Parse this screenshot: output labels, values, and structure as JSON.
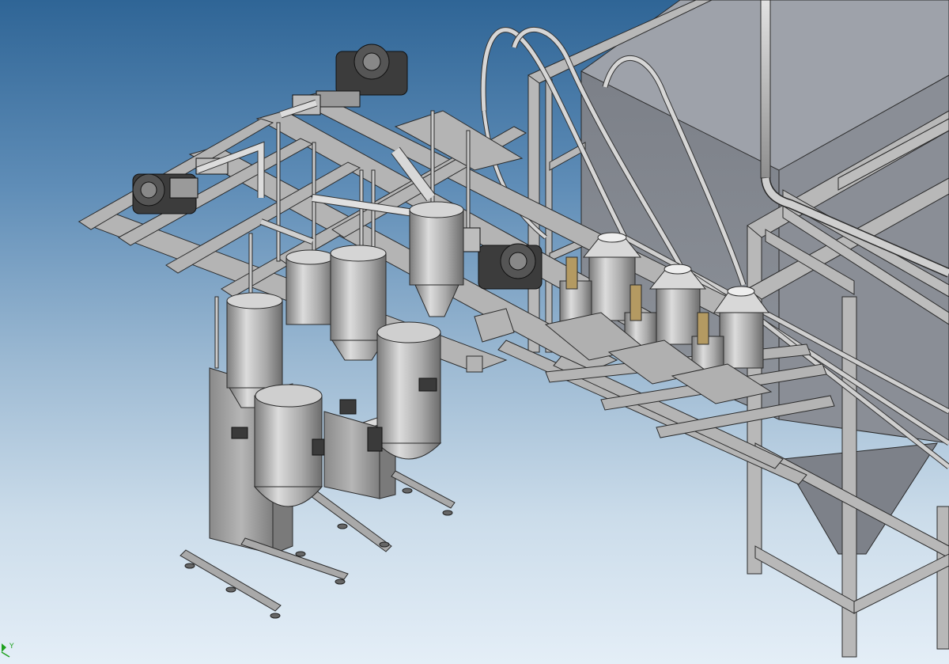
{
  "viewport": {
    "triad_axis_label": "Y",
    "colors": {
      "steel_light": "#c4c4c4",
      "steel_mid": "#9a9a9a",
      "steel_dark": "#6a6a6a",
      "steel_line": "#2a2a2a",
      "hopper_face": "#7a7d83",
      "triad_green": "#1fa11f"
    }
  }
}
